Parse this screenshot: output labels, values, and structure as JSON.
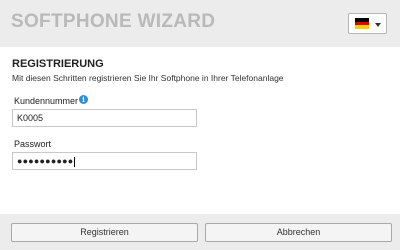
{
  "header": {
    "title": "SOFTPHONE WIZARD",
    "language": {
      "selected": "Deutsch",
      "icon": "germany-flag-icon"
    }
  },
  "registration": {
    "title": "REGISTRIERUNG",
    "description": "Mit diesen Schritten registrieren Sie Ihr Softphone in Ihrer Telefonanlage",
    "username": {
      "label": "Kundennummer",
      "value": "K0005",
      "info_icon": "info-icon"
    },
    "password": {
      "label": "Passwort",
      "masked_value": "●●●●●●●●●●"
    }
  },
  "footer": {
    "register_label": "Registrieren",
    "cancel_label": "Abbrechen"
  },
  "colors": {
    "header_bg": "#ececec",
    "title_text": "#b9b9b9",
    "info_accent": "#2a8fd8"
  }
}
